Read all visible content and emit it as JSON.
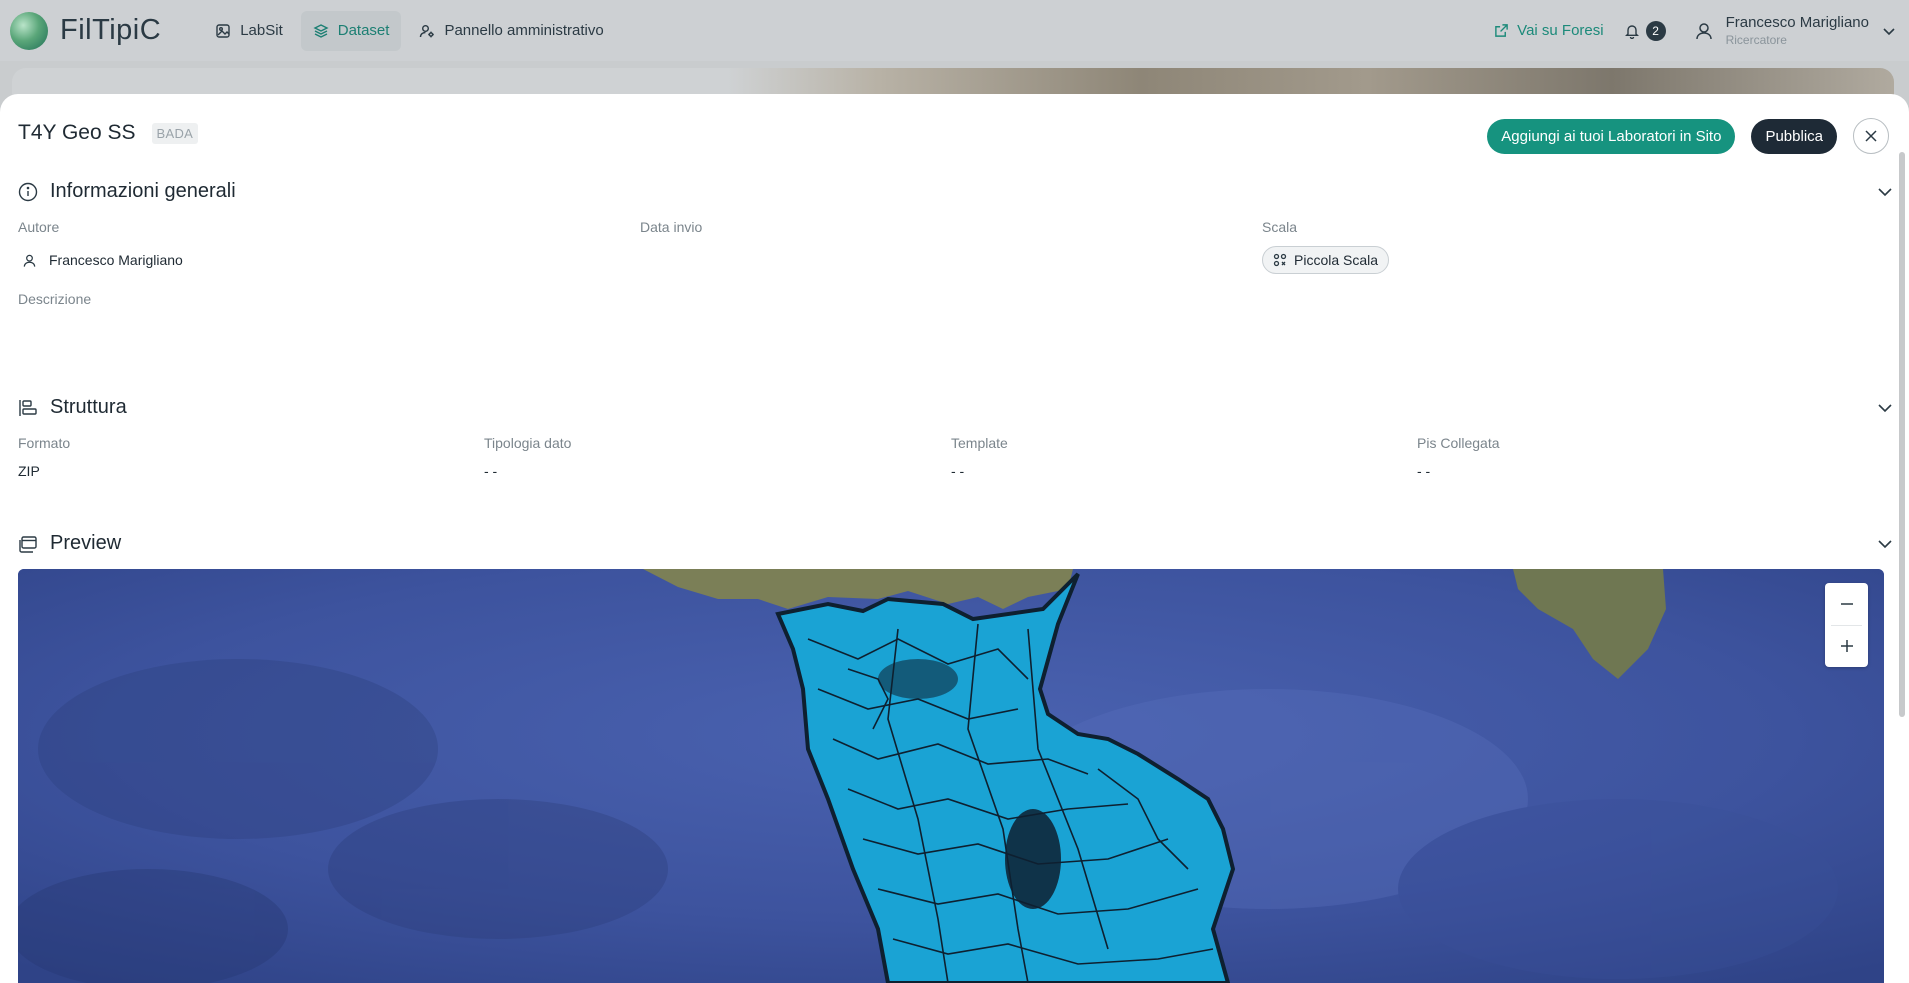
{
  "app": {
    "name": "FilTipiC"
  },
  "nav": {
    "items": [
      {
        "label": "LabSit",
        "icon": "image-icon"
      },
      {
        "label": "Dataset",
        "icon": "layers-icon",
        "active": true
      },
      {
        "label": "Pannello amministrativo",
        "icon": "user-settings-icon"
      }
    ]
  },
  "topright": {
    "foresi_label": "Vai su Foresi",
    "notifications_count": "2",
    "user_name": "Francesco Marigliano",
    "user_role": "Ricercatore"
  },
  "dataset": {
    "title": "T4Y Geo SS",
    "tag": "BADA",
    "add_button": "Aggiungi ai tuoi Laboratori in Sito",
    "publish_button": "Pubblica"
  },
  "general": {
    "title": "Informazioni generali",
    "author_label": "Autore",
    "author_value": "Francesco Marigliano",
    "date_label": "Data invio",
    "scale_label": "Scala",
    "scale_value": "Piccola Scala",
    "description_label": "Descrizione"
  },
  "structure": {
    "title": "Struttura",
    "format_label": "Formato",
    "format_value": "ZIP",
    "type_label": "Tipologia dato",
    "type_value": "- -",
    "template_label": "Template",
    "template_value": "- -",
    "pis_label": "Pis Collegata",
    "pis_value": "- -"
  },
  "preview": {
    "title": "Preview"
  },
  "colors": {
    "accent": "#16937f",
    "dark_button": "#1e2a36",
    "sea": "#3f55a0",
    "overlay_fill": "#1aa3d4"
  }
}
